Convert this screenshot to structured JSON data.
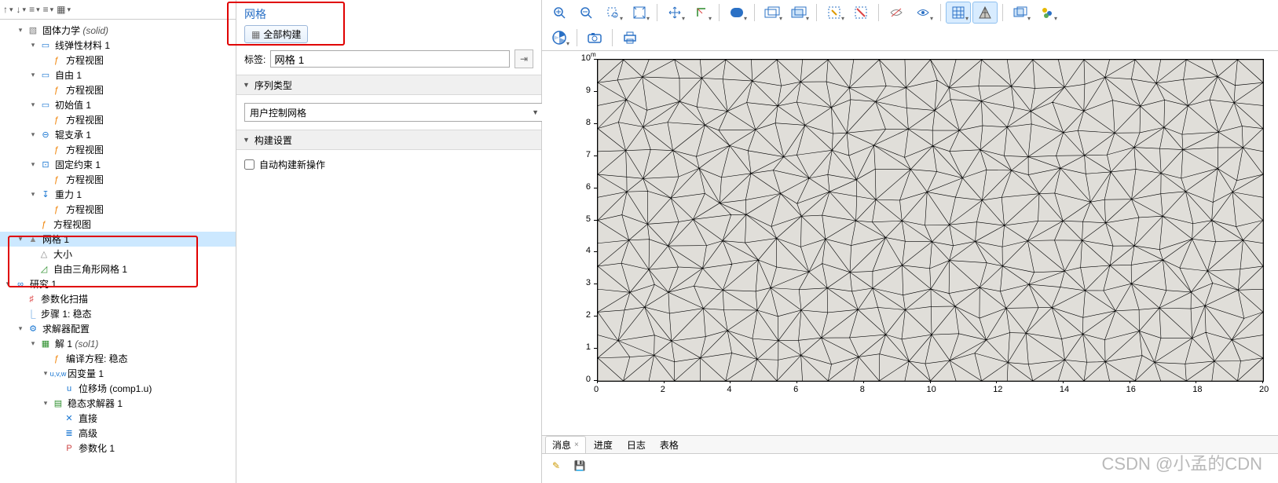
{
  "tree": {
    "solid_label": "固体力学",
    "solid_tag": "(solid)",
    "linear_elastic": "线弹性材料 1",
    "eq_view": "方程视图",
    "free_bc": "自由 1",
    "initial": "初始值 1",
    "roller": "辊支承 1",
    "fixed": "固定约束 1",
    "gravity": "重力 1",
    "mesh_node": "网格 1",
    "size_node": "大小",
    "free_tri": "自由三角形网格 1",
    "study": "研究 1",
    "param_sweep": "参数化扫描",
    "step": "步骤 1: 稳态",
    "solver_cfg": "求解器配置",
    "sol": "解 1",
    "sol_tag": "(sol1)",
    "compile": "编译方程: 稳态",
    "depvar": "因变量 1",
    "disp_field": "位移场 (comp1.u)",
    "stat_solver": "稳态求解器 1",
    "direct": "直接",
    "advanced": "高级",
    "parametric": "参数化 1"
  },
  "settings": {
    "title": "网格",
    "build_all": "全部构建",
    "label_label": "标签:",
    "label_value": "网格 1",
    "section_seqtype": "序列类型",
    "seqtype_value": "用户控制网格",
    "section_build": "构建设置",
    "auto_new_op": "自动构建新操作"
  },
  "tabs": {
    "messages": "消息",
    "progress": "进度",
    "log": "日志",
    "table": "表格"
  },
  "chart_data": {
    "type": "mesh",
    "xlim": [
      0,
      20
    ],
    "ylim": [
      0,
      10
    ],
    "x_ticks": [
      0,
      2,
      4,
      6,
      8,
      10,
      12,
      14,
      16,
      18,
      20
    ],
    "y_ticks": [
      0,
      1,
      2,
      3,
      4,
      5,
      6,
      7,
      8,
      9,
      10
    ],
    "unit": "m",
    "title": "",
    "xlabel": "",
    "ylabel": "",
    "description": "Free triangular mesh on a 20×10 rectangular 2D domain"
  },
  "watermark": "CSDN @小孟的CDN"
}
